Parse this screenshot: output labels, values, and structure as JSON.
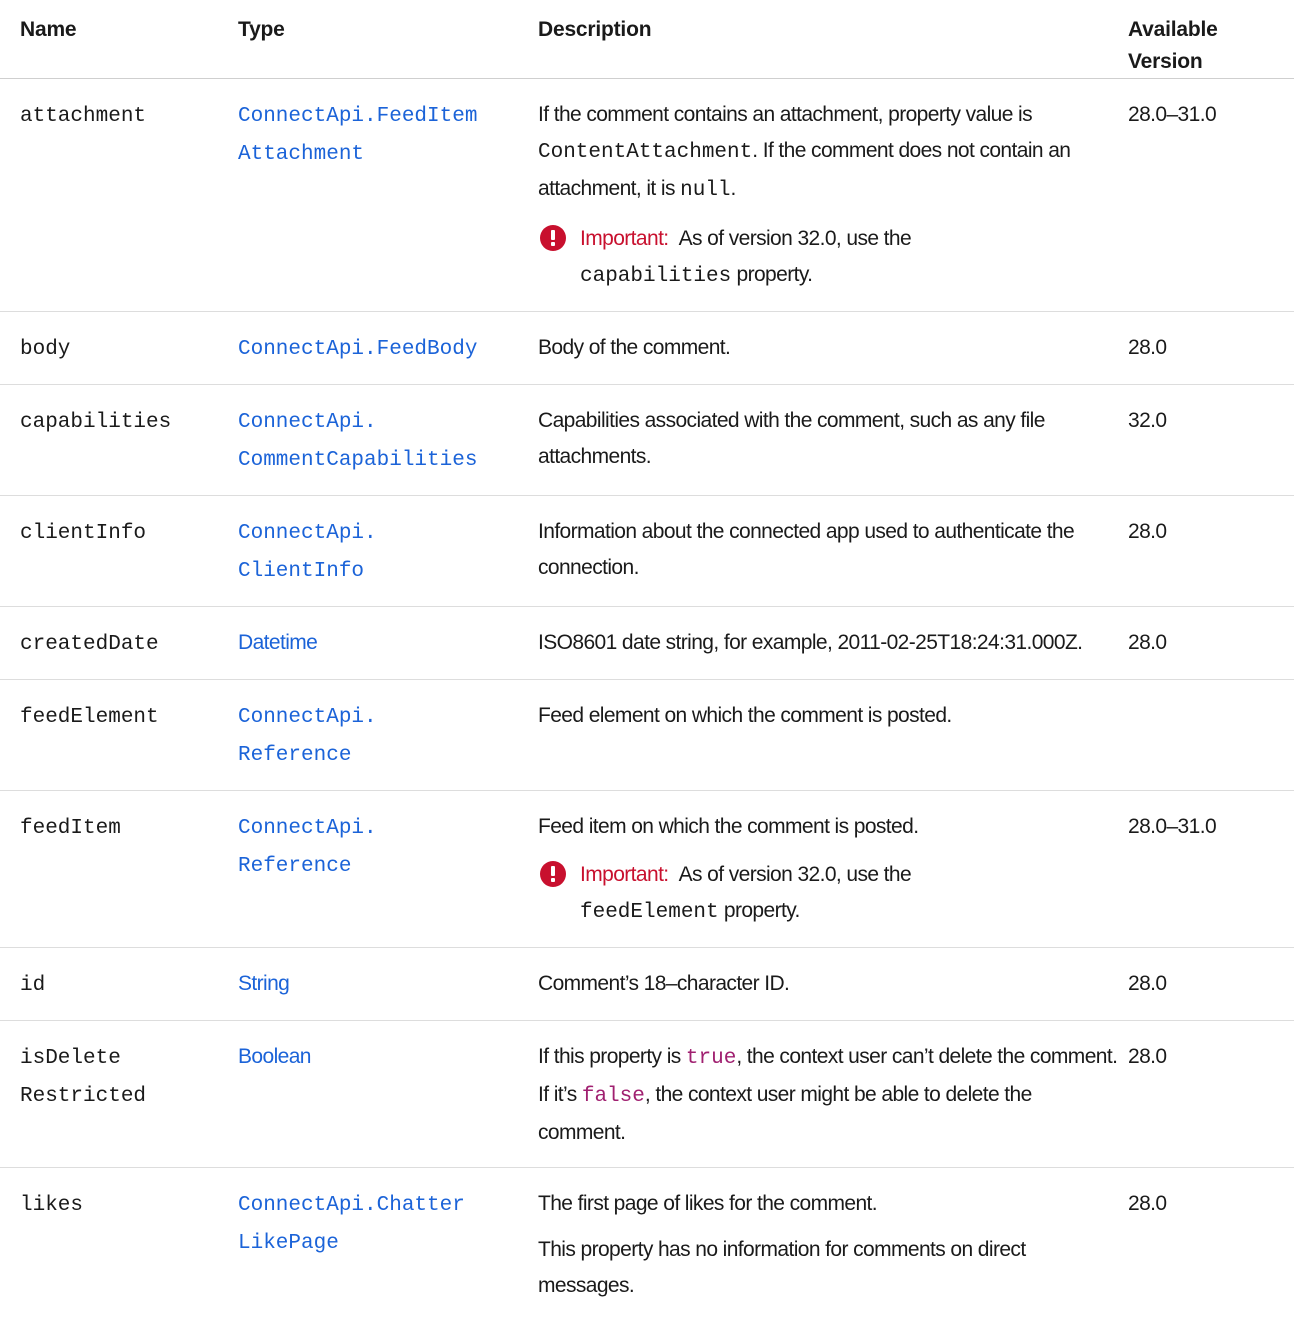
{
  "headers": {
    "name": "Name",
    "type": "Type",
    "description": "Description",
    "version_line1": "Available",
    "version_line2": "Version"
  },
  "rows": [
    {
      "name": "attachment",
      "type_line1": "ConnectApi.FeedItem",
      "type_line2": "Attachment",
      "desc_p1": "If the comment contains an attachment, property value is",
      "desc_code1": "ContentAttachment",
      "desc_p1b": ". If the comment does not contain an attachment, it is",
      "desc_code2": "null",
      "desc_p1c": ".",
      "important_label": "Important:",
      "important_text": "As of version 32.0, use the",
      "important_code": "capabilities",
      "important_tail": "property.",
      "version": "28.0–31.0"
    },
    {
      "name": "body",
      "type_line1": "ConnectApi.FeedBody",
      "description": "Body of the comment.",
      "version": "28.0"
    },
    {
      "name": "capabilities",
      "type_line1": "ConnectApi.",
      "type_line2": "CommentCapabilities",
      "description": "Capabilities associated with the comment, such as any file attachments.",
      "version": "32.0"
    },
    {
      "name": "clientInfo",
      "type_line1": "ConnectApi.",
      "type_line2": "ClientInfo",
      "description": "Information about the connected app used to authenticate the connection.",
      "version": "28.0"
    },
    {
      "name": "createdDate",
      "type_line1": "Datetime",
      "description": "ISO8601 date string, for example, 2011-02-25T18:24:31.000Z.",
      "version": "28.0"
    },
    {
      "name": "feedElement",
      "type_line1": "ConnectApi.",
      "type_line2": "Reference",
      "description": "Feed element on which the comment is posted.",
      "version": ""
    },
    {
      "name": "feedItem",
      "type_line1": "ConnectApi.",
      "type_line2": "Reference",
      "description": "Feed item on which the comment is posted.",
      "important_label": "Important:",
      "important_text": "As of version 32.0, use the",
      "important_code": "feedElement",
      "important_tail": "property.",
      "version": "28.0–31.0"
    },
    {
      "name": "id",
      "type_line1": "String",
      "description": "Comment’s 18–character ID.",
      "version": "28.0"
    },
    {
      "name_line1": "isDelete",
      "name_line2": "Restricted",
      "type_line1": "Boolean",
      "desc_a": "If this property is",
      "desc_code_true": "true",
      "desc_b": ", the context user can’t delete the comment. If it’s",
      "desc_code_false": "false",
      "desc_c": ", the context user might be able to delete the comment.",
      "version": "28.0"
    },
    {
      "name": "likes",
      "type_line1": "ConnectApi.Chatter",
      "type_line2": "LikePage",
      "desc_p1": "The first page of likes for the comment.",
      "desc_p2": "This property has no information for comments on direct messages.",
      "version": "28.0"
    }
  ],
  "colors": {
    "link": "#1b63d8",
    "important": "#c8102e",
    "code_literal": "#a02070"
  }
}
